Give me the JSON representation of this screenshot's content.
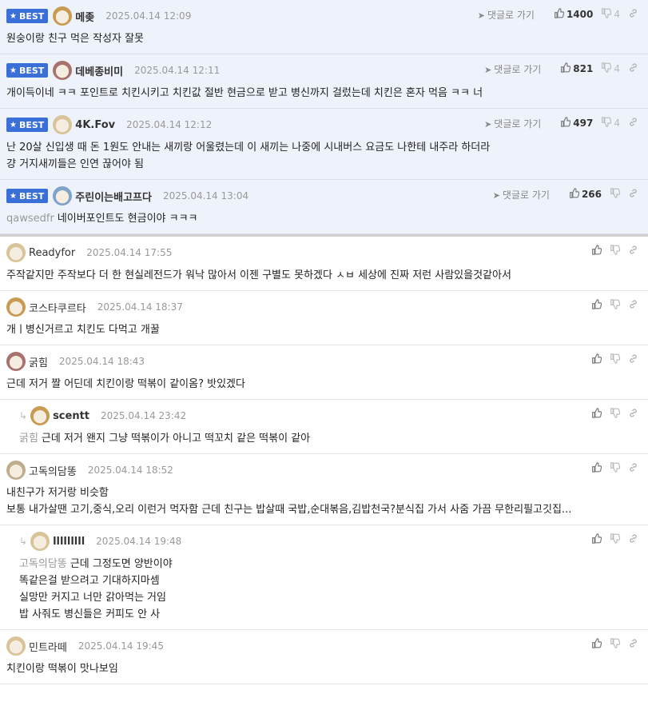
{
  "ui": {
    "best_label": "BEST",
    "goto_label": "댓글로 가기"
  },
  "best": [
    {
      "nick": "메좆",
      "date": "2025.04.14 12:09",
      "up": "1400",
      "down": "4",
      "avatar_color": "#c99a52",
      "lines": [
        "원숭이랑 친구 먹은 작성자 잘못"
      ]
    },
    {
      "nick": "데베종비미",
      "date": "2025.04.14 12:11",
      "up": "821",
      "down": "4",
      "avatar_color": "#a8736e",
      "lines": [
        "개이득이네 ㅋㅋ 포인트로 치킨시키고 치킨값 절반 현금으로 받고 병신까지 걸렀는데 치킨은 혼자 먹음 ㅋㅋ 너"
      ]
    },
    {
      "nick": "4K.Fov",
      "date": "2025.04.14 12:12",
      "up": "497",
      "down": "4",
      "avatar_color": "#d9c49a",
      "lines": [
        "난 20살 신입생 때 돈 1원도 안내는 새끼랑 어울렸는데 이 새끼는 나중에 시내버스 요금도 나한테 내주라 하더라",
        "걍 거지새끼들은 인연 끊어야 됨"
      ]
    },
    {
      "nick": "주린이는배고프다",
      "date": "2025.04.14 13:04",
      "up": "266",
      "down": "",
      "avatar_color": "#7fa3c9",
      "mention": "qawsedfr",
      "lines": [
        "네이버포인트도 현금이야 ㅋㅋㅋ"
      ]
    }
  ],
  "comments": [
    {
      "nick": "Readyfor",
      "date": "2025.04.14 17:55",
      "reply": false,
      "avatar_color": "#d9c49a",
      "lines": [
        "주작같지만 주작보다 더 한 현실레전드가 워낙 많아서 이젠 구별도 못하겠다 ㅅㅂ 세상에 진짜 저런 사람있을것같아서"
      ]
    },
    {
      "nick": "코스타쿠르타",
      "date": "2025.04.14 18:37",
      "reply": false,
      "avatar_color": "#c99a52",
      "lines": [
        "개ㅣ병신거르고 치킨도 다먹고 개꿀"
      ]
    },
    {
      "nick": "굵힘",
      "date": "2025.04.14 18:43",
      "reply": false,
      "avatar_color": "#a8736e",
      "lines": [
        "근데 저거 짤 어딘데 치킨이랑 떡볶이 같이옴? 밧있겠다"
      ]
    },
    {
      "nick": "scentt",
      "date": "2025.04.14 23:42",
      "reply": true,
      "avatar_color": "#c99a52",
      "mention": "굵힘",
      "lines": [
        "근데 저거 왠지 그냥 떡볶이가 아니고 떡꼬치 같은 떡볶이 같아"
      ]
    },
    {
      "nick": "고독의담똥",
      "date": "2025.04.14 18:52",
      "reply": false,
      "avatar_color": "#bfae8e",
      "lines": [
        "내친구가 저거랑 비슷함",
        "보통 내가살땐 고기,중식,오리 이런거 먹자함 근데 친구는 밥살때 국밥,순대볶음,김밥천국?분식집 가서 사줌 가끔 무한리필고깃집..."
      ]
    },
    {
      "nick": "lllllllll",
      "date": "2025.04.14 19:48",
      "reply": true,
      "avatar_color": "#d9c49a",
      "mention": "고독의담똥",
      "lines": [
        "근데 그정도면 양반이야",
        "똑같은걸 받으려고 기대하지마셈",
        "실망만 커지고 너만 갉아먹는 거임",
        "밥 사줘도 병신들은 커피도 안 사"
      ]
    },
    {
      "nick": "민트라떼",
      "date": "2025.04.14 19:45",
      "reply": false,
      "avatar_color": "#d9c49a",
      "lines": [
        "치킨이랑 떡볶이 맛나보임"
      ]
    }
  ]
}
